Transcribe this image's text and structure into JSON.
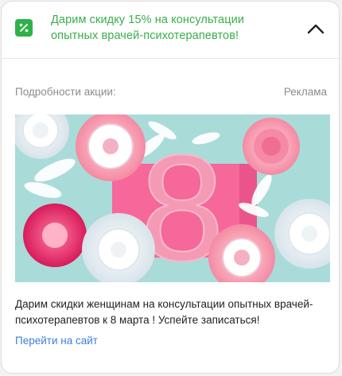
{
  "header": {
    "title": "Дарим скидку 15% на консультации опытных врачей-психотерапевтов!",
    "icon": "percent-icon",
    "accent_color": "#3aae4b",
    "collapse_icon": "chevron-up-icon"
  },
  "details": {
    "label": "Подробности акции:",
    "ad_label": "Реклама"
  },
  "banner": {
    "big_text": "8",
    "image": "paper-flowers-march-8-image"
  },
  "description": "Дарим скидки женщинам на консультации опытных врачей-психотерапевтов к 8 марта ! Успейте записаться!",
  "link": {
    "label": "Перейти на сайт",
    "color": "#3b7fe0"
  }
}
